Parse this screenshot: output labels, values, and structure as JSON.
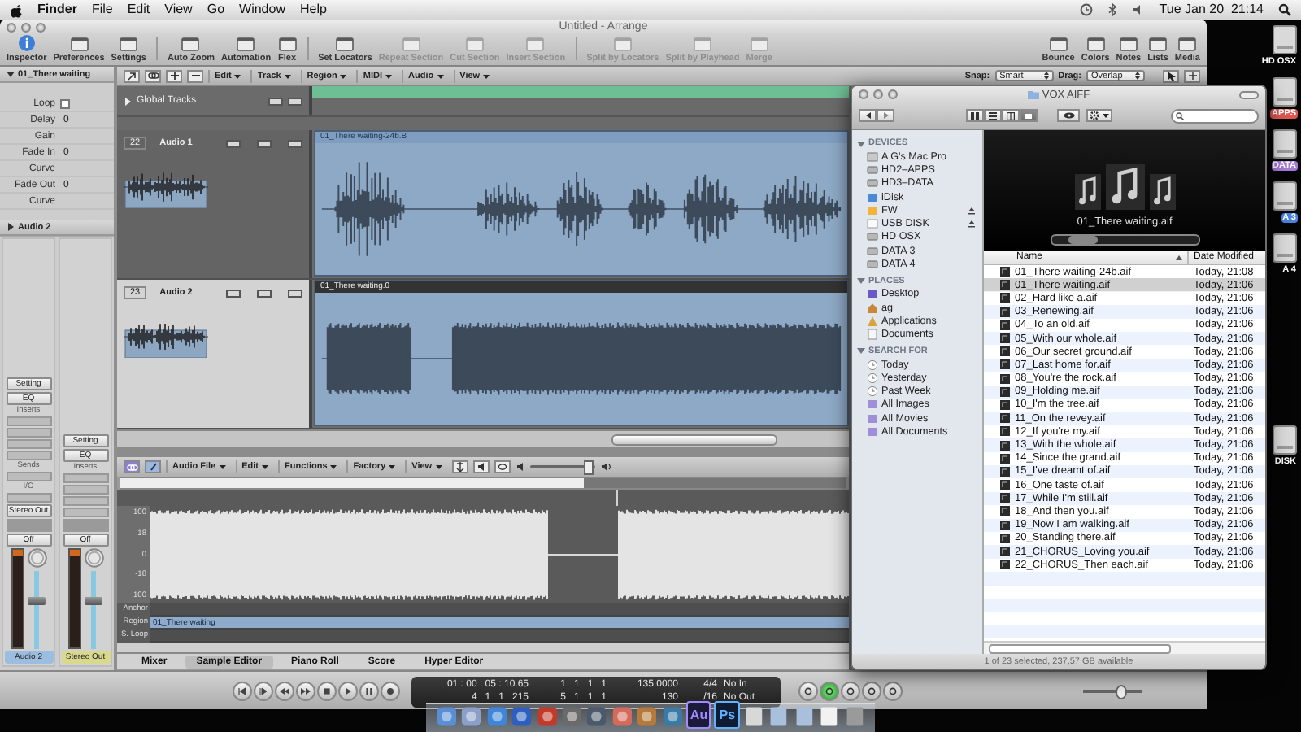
{
  "menubar": {
    "app": "Finder",
    "menus": [
      "File",
      "Edit",
      "View",
      "Go",
      "Window",
      "Help"
    ],
    "clock": "Tue Jan 20  21:14"
  },
  "arrange": {
    "title": "Untitled - Arrange",
    "toolbar_groups": [
      [
        {
          "label": "Inspector",
          "disabled": false
        },
        {
          "label": "Preferences",
          "disabled": false
        },
        {
          "label": "Settings",
          "disabled": false
        }
      ],
      [
        {
          "label": "Auto Zoom",
          "disabled": false
        },
        {
          "label": "Automation",
          "disabled": false
        },
        {
          "label": "Flex",
          "disabled": false
        }
      ],
      [
        {
          "label": "Set Locators",
          "disabled": false
        },
        {
          "label": "Repeat Section",
          "disabled": true
        },
        {
          "label": "Cut Section",
          "disabled": true
        },
        {
          "label": "Insert Section",
          "disabled": true
        }
      ],
      [
        {
          "label": "Split by Locators",
          "disabled": true
        },
        {
          "label": "Split by Playhead",
          "disabled": true
        },
        {
          "label": "Merge",
          "disabled": true
        }
      ]
    ],
    "toolbar_right": [
      {
        "label": "Bounce",
        "disabled": false
      },
      {
        "label": "Colors",
        "disabled": false
      },
      {
        "label": "Notes",
        "disabled": false
      },
      {
        "label": "Lists",
        "disabled": false
      },
      {
        "label": "Media",
        "disabled": false
      }
    ],
    "local_menus": [
      "Edit",
      "Track",
      "Region",
      "MIDI",
      "Audio",
      "View"
    ],
    "snap": {
      "label": "Snap:",
      "value": "Smart"
    },
    "drag": {
      "label": "Drag:",
      "value": "Overlap"
    },
    "inspector": {
      "region": {
        "name": "01_There waiting",
        "expanded": true
      },
      "params": [
        {
          "label": "Loop",
          "kind": "checkbox",
          "checked": false
        },
        {
          "label": "Delay",
          "kind": "value",
          "value": "0"
        },
        {
          "label": "Gain",
          "kind": "label"
        },
        {
          "label": "Fade In",
          "kind": "value",
          "value": "0"
        },
        {
          "label": "Curve",
          "kind": "label"
        },
        {
          "label": "Fade Out",
          "kind": "value",
          "value": "0"
        },
        {
          "label": "Curve",
          "kind": "label"
        }
      ],
      "track": {
        "name": "Audio 2",
        "expanded": false
      },
      "strips": [
        {
          "setting": "Setting",
          "eq": "EQ",
          "inserts": "Inserts",
          "sends": "Sends",
          "io": "I/O",
          "output": "Stereo Out",
          "automation": "Off",
          "name": "Audio 2",
          "color": "#9cbde0",
          "level": 0.62
        },
        {
          "setting": "Setting",
          "eq": "EQ",
          "inserts": "Inserts",
          "automation": "Off",
          "name": "Stereo Out",
          "color": "#d9d98e",
          "level": 0.62
        }
      ]
    },
    "global_tracks": {
      "label": "Global Tracks",
      "expanded": false
    },
    "tracks": [
      {
        "number": "22",
        "name": "Audio 1",
        "selected": false,
        "region": {
          "name": "01_There waiting-24b.B",
          "selected": false
        }
      },
      {
        "number": "23",
        "name": "Audio 2",
        "selected": true,
        "region": {
          "name": "01_There waiting.0",
          "selected": true
        }
      }
    ],
    "sample_editor": {
      "menus": [
        "Audio File",
        "Edit",
        "Functions",
        "Factory",
        "View"
      ],
      "zoom": {
        "level": 0.88
      },
      "scale": [
        "100",
        "18",
        "0",
        "-18",
        "-100"
      ],
      "lanes": [
        {
          "label": "Anchor"
        },
        {
          "label": "Region",
          "value": "01_There waiting"
        },
        {
          "label": "S. Loop"
        }
      ]
    },
    "tabs": [
      {
        "label": "Mixer",
        "selected": false
      },
      {
        "label": "Sample Editor",
        "selected": true
      },
      {
        "label": "Piano Roll",
        "selected": false
      },
      {
        "label": "Score",
        "selected": false
      },
      {
        "label": "Hyper Editor",
        "selected": false
      }
    ],
    "transport": {
      "time": "01 : 00 : 05 : 10.65",
      "bars": "4   1   1   215",
      "left_locator": "1   1   1   1",
      "right_locator": "5   1   1   1",
      "tempo": "135.0000",
      "division": "130",
      "signature": "4/4",
      "subdivision": "/16",
      "midi_in": "No In",
      "midi_out": "No Out",
      "master": {
        "level": 0.6
      }
    }
  },
  "finder": {
    "title": "VOX AIFF",
    "view_modes": [
      {
        "selected": false
      },
      {
        "selected": false
      },
      {
        "selected": false
      },
      {
        "selected": true
      }
    ],
    "sidebar": [
      {
        "heading": "DEVICES",
        "expanded": true,
        "items": [
          {
            "label": "A G's Mac Pro",
            "kind": "computer",
            "ejectable": false
          },
          {
            "label": "HD2–APPS",
            "kind": "drive",
            "ejectable": false
          },
          {
            "label": "HD3–DATA",
            "kind": "drive",
            "ejectable": false
          },
          {
            "label": "iDisk",
            "kind": "idisk",
            "ejectable": false
          },
          {
            "label": "FW",
            "kind": "fw",
            "ejectable": true
          },
          {
            "label": "USB DISK",
            "kind": "blank",
            "ejectable": true
          },
          {
            "label": "HD OSX",
            "kind": "drive",
            "ejectable": false
          },
          {
            "label": "DATA 3",
            "kind": "drive",
            "ejectable": false
          },
          {
            "label": "DATA 4",
            "kind": "drive",
            "ejectable": false
          }
        ]
      },
      {
        "heading": "PLACES",
        "expanded": true,
        "items": [
          {
            "label": "Desktop",
            "kind": "desktop"
          },
          {
            "label": "ag",
            "kind": "home"
          },
          {
            "label": "Applications",
            "kind": "apps"
          },
          {
            "label": "Documents",
            "kind": "docs"
          }
        ]
      },
      {
        "heading": "SEARCH FOR",
        "expanded": true,
        "items": [
          {
            "label": "Today",
            "kind": "clock"
          },
          {
            "label": "Yesterday",
            "kind": "clock"
          },
          {
            "label": "Past Week",
            "kind": "clock"
          },
          {
            "label": "All Images",
            "kind": "smart"
          },
          {
            "label": "All Movies",
            "kind": "smart"
          },
          {
            "label": "All Documents",
            "kind": "smart"
          }
        ]
      }
    ],
    "preview": {
      "caption": "01_There waiting.aif"
    },
    "columns": [
      "Name",
      "Date Modified"
    ],
    "files": [
      {
        "name": "01_There waiting-24b.aif",
        "date": "Today, 21:08",
        "selected": false
      },
      {
        "name": "01_There waiting.aif",
        "date": "Today, 21:06",
        "selected": true
      },
      {
        "name": "02_Hard like a.aif",
        "date": "Today, 21:06",
        "selected": false
      },
      {
        "name": "03_Renewing.aif",
        "date": "Today, 21:06",
        "selected": false
      },
      {
        "name": "04_To an old.aif",
        "date": "Today, 21:06",
        "selected": false
      },
      {
        "name": "05_With our whole.aif",
        "date": "Today, 21:06",
        "selected": false
      },
      {
        "name": "06_Our secret ground.aif",
        "date": "Today, 21:06",
        "selected": false
      },
      {
        "name": "07_Last home for.aif",
        "date": "Today, 21:06",
        "selected": false
      },
      {
        "name": "08_You're the rock.aif",
        "date": "Today, 21:06",
        "selected": false
      },
      {
        "name": "09_Holding me.aif",
        "date": "Today, 21:06",
        "selected": false
      },
      {
        "name": "10_I'm the tree.aif",
        "date": "Today, 21:06",
        "selected": false
      },
      {
        "name": "11_On the revey.aif",
        "date": "Today, 21:06",
        "selected": false
      },
      {
        "name": "12_If you're my.aif",
        "date": "Today, 21:06",
        "selected": false
      },
      {
        "name": "13_With the whole.aif",
        "date": "Today, 21:06",
        "selected": false
      },
      {
        "name": "14_Since the grand.aif",
        "date": "Today, 21:06",
        "selected": false
      },
      {
        "name": "15_I've dreamt of.aif",
        "date": "Today, 21:06",
        "selected": false
      },
      {
        "name": "16_One taste of.aif",
        "date": "Today, 21:06",
        "selected": false
      },
      {
        "name": "17_While I'm still.aif",
        "date": "Today, 21:06",
        "selected": false
      },
      {
        "name": "18_And then you.aif",
        "date": "Today, 21:06",
        "selected": false
      },
      {
        "name": "19_Now I am walking.aif",
        "date": "Today, 21:06",
        "selected": false
      },
      {
        "name": "20_Standing there.aif",
        "date": "Today, 21:06",
        "selected": false
      },
      {
        "name": "21_CHORUS_Loving you.aif",
        "date": "Today, 21:06",
        "selected": false
      },
      {
        "name": "22_CHORUS_Then each.aif",
        "date": "Today, 21:06",
        "selected": false
      }
    ],
    "status": "1 of 23 selected, 237,57 GB available"
  },
  "desktop": {
    "drives": [
      {
        "label": "HD OSX"
      },
      {
        "label": "APPS",
        "color": "#e0564e"
      },
      {
        "label": "DATA",
        "color": "#a47ad8"
      },
      {
        "label": "A 3",
        "color": "#4a82e0"
      },
      {
        "label": "A 4"
      },
      {
        "label": "DISK"
      }
    ]
  },
  "dock": {
    "badges": [
      "Au",
      "Ps"
    ]
  }
}
